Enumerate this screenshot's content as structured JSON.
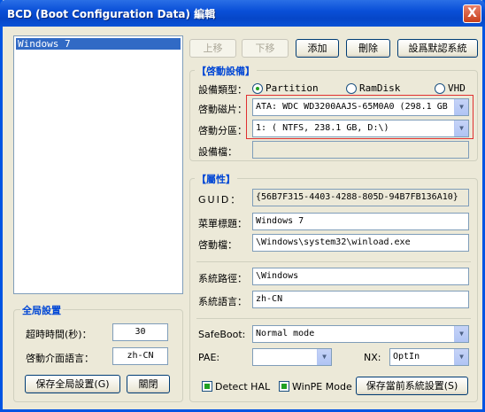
{
  "window": {
    "title": "BCD (Boot Configuration Data) 編輯",
    "close_label": "X"
  },
  "boot_list": {
    "items": [
      "Windows 7"
    ]
  },
  "toolbar": {
    "up_label": "上移",
    "down_label": "下移",
    "add_label": "添加",
    "delete_label": "刪除",
    "default_label": "設爲默認系統"
  },
  "boot_device": {
    "group_title": "【啓動設備】",
    "device_type_label": "設備類型：",
    "radio_partition": "Partition",
    "radio_ramdisk": "RamDisk",
    "radio_vhd": "VHD",
    "selected_type": "Partition",
    "boot_disk_label": "啓動磁片：",
    "boot_disk_value": "ATA: WDC WD3200AAJS-65M0A0 (298.1 GB",
    "boot_partition_label": "啓動分區：",
    "boot_partition_value": "1: ( NTFS, 238.1 GB, D:\\)",
    "device_file_label": "設備檔：",
    "device_file_value": ""
  },
  "properties": {
    "group_title": "【屬性】",
    "guid_label": "GUID：",
    "guid_value": "{56B7F315-4403-4288-805D-94B7FB136A10}",
    "menu_title_label": "菜單標題：",
    "menu_title_value": "Windows 7",
    "boot_file_label": "啓動檔：",
    "boot_file_value": "\\Windows\\system32\\winload.exe",
    "system_path_label": "系統路徑：",
    "system_path_value": "\\Windows",
    "system_lang_label": "系統語言：",
    "system_lang_value": "zh-CN",
    "safeboot_label": "SafeBoot:",
    "safeboot_value": "Normal mode",
    "pae_label": "PAE:",
    "pae_value": "",
    "nx_label": "NX:",
    "nx_value": "OptIn",
    "detect_hal_label": "Detect HAL",
    "winpe_label": "WinPE Mode",
    "save_current_label": "保存當前系統設置(S)"
  },
  "global": {
    "group_title": "全局設置",
    "timeout_label": "超時時間(秒)：",
    "timeout_value": "30",
    "boot_lang_label": "啓動介面語言：",
    "boot_lang_value": "zh-CN",
    "save_global_label": "保存全局設置(G)",
    "close_label": "關閉"
  },
  "colors": {
    "titlebar": "#0a50d8",
    "window_bg": "#ece9d8",
    "group_title": "#0046d5",
    "highlight_box": "#e03030",
    "selection": "#316ac5"
  }
}
